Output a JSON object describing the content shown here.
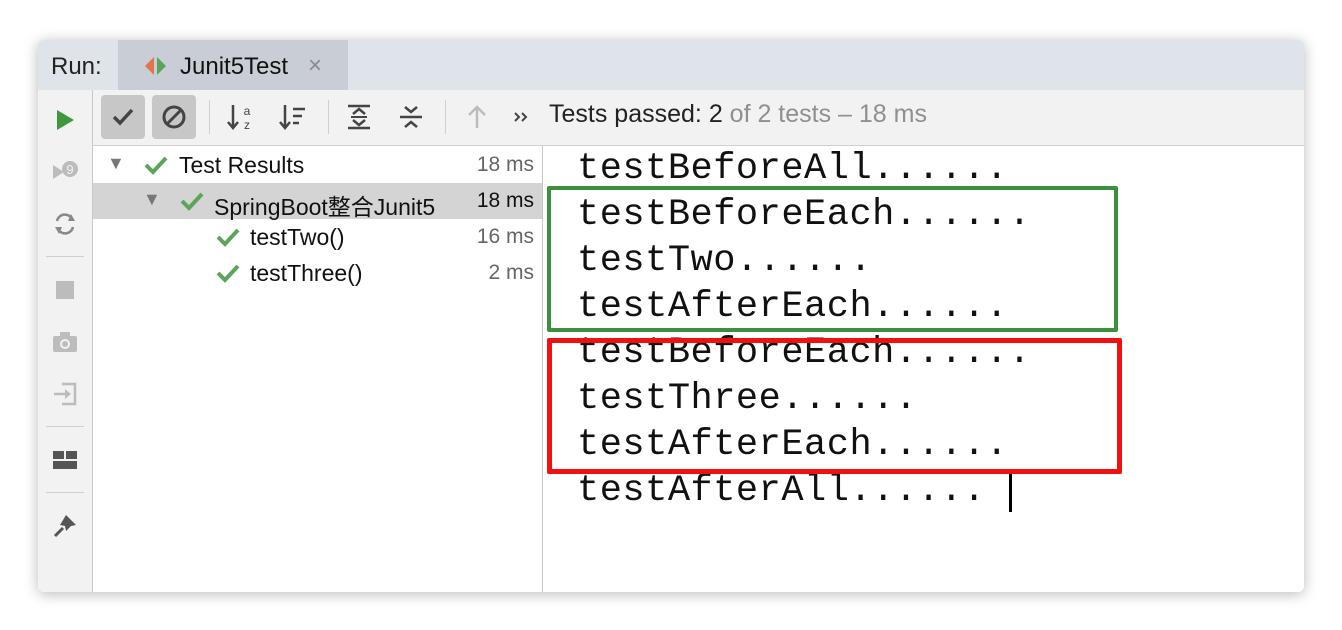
{
  "run_label": "Run:",
  "tab": {
    "label": "Junit5Test",
    "close_glyph": "×"
  },
  "status": {
    "prefix": "Tests passed: ",
    "passed": "2",
    "of_text": " of 2 tests – 18 ms"
  },
  "tree": [
    {
      "label": "Test Results",
      "time": "18 ms"
    },
    {
      "label": "SpringBoot整合Junit5",
      "time": "18 ms"
    },
    {
      "label": "testTwo()",
      "time": "16 ms"
    },
    {
      "label": "testThree()",
      "time": "2 ms"
    }
  ],
  "console": [
    "testBeforeAll......",
    "testBeforeEach......",
    "testTwo......",
    "testAfterEach......",
    "testBeforeEach......",
    "testThree......",
    "testAfterEach......",
    "testAfterAll......"
  ],
  "colors": {
    "pass_green": "#5aa55a",
    "run_green": "#3f9a3f",
    "box_green": "#3c8f3c",
    "box_red": "#f01010"
  }
}
